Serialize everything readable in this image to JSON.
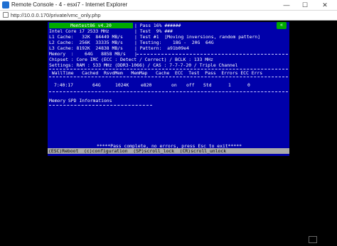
{
  "window": {
    "title": "Remote Console - 4 - esxi7 - Internet Explorer",
    "min_glyph": "—",
    "max_glyph": "☐",
    "close_glyph": "✕",
    "address": "http://10.0.0.170/private/vmc_only.php"
  },
  "memtest": {
    "version": "Memtest86  v4.20",
    "pass_line": "| Pass 16% ######",
    "cpu": "Intel Core i7 2533 MHz",
    "test_pct": "| Test  9% ###",
    "l1": "L1 Cache:   32K  84449 MB/s",
    "test_desc": "| Test #1  [Moving inversions, random pattern]",
    "l2": "L2 Cache:  256K  33335 MB/s",
    "testing": "| Testing:    18G -  20G  64G",
    "l3": "L3 Cache: 8192K  24838 MB/s",
    "pattern": "| Pattern:  a91b09e4",
    "memory": "Memory  :    64G   8858 MB/s",
    "memory_sep": "|",
    "chipset": "Chipset : Core IMC (ECC : Detect / Correct) / BCLK : 133 MHz",
    "settings": "Settings: RAM : 533 MHz (DDR3-1066) / CAS : 7-7-7-20 / Triple Channel",
    "columns_header": " WallTime   Cached  RsvdMem   MemMap   Cache  ECC  Test  Pass  Errors ECC Errs",
    "row_walltime": "7:40:17",
    "row_cached": "64G",
    "row_rsvdmem": "1024K",
    "row_memmap": "e820",
    "row_cache": "on",
    "row_ecc": "off",
    "row_test": "Std",
    "row_pass": "1",
    "row_errors": "0",
    "spd_title": "Memory SPD Informations",
    "status_msg": "*****Pass complete, no errors, press Esc to exit*****",
    "footer": "(ESC)Reboot  (c)configuration  (SP)scroll_lock  (CR)scroll_unlock",
    "badge": "«"
  },
  "colors": {
    "screen_bg": "#0000aa",
    "header_green": "#00aa00",
    "footer_bar": "#aaaaaa"
  },
  "icons": [
    "app-icon",
    "page-icon",
    "minimize-icon",
    "maximize-icon",
    "close-icon",
    "resize-icon",
    "collapse-badge-icon"
  ]
}
